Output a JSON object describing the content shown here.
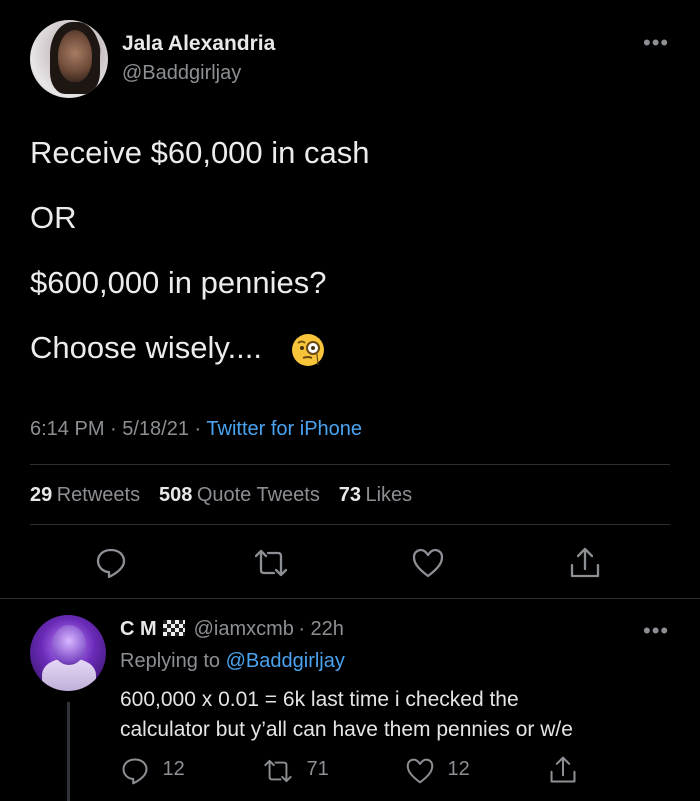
{
  "tweet": {
    "author_name": "Jala Alexandria",
    "author_handle": "@Baddgirljay",
    "lines": [
      "Receive $60,000 in cash",
      "OR",
      "$600,000 in pennies?",
      "Choose wisely...."
    ],
    "emoji": "face-with-monocle",
    "time": "6:14 PM · 5/18/21 · ",
    "source": "Twitter for iPhone",
    "stats": {
      "retweets_count": "29",
      "retweets_label": "Retweets",
      "quotes_count": "508",
      "quotes_label": "Quote Tweets",
      "likes_count": "73",
      "likes_label": "Likes"
    }
  },
  "reply": {
    "author_name": "C M",
    "author_handle": "@iamxcmb",
    "time": "· 22h",
    "replying_prefix": "Replying to ",
    "replying_to": "@Baddgirljay",
    "text_line1": "600,000 x 0.01 = 6k  last time i checked the",
    "text_line2": "calculator but y’all can have them pennies or w/e",
    "replies": "12",
    "retweets": "71",
    "likes": "12"
  },
  "colors": {
    "background": "#000000",
    "link": "#4aa3f0",
    "muted": "#8c8f93"
  }
}
